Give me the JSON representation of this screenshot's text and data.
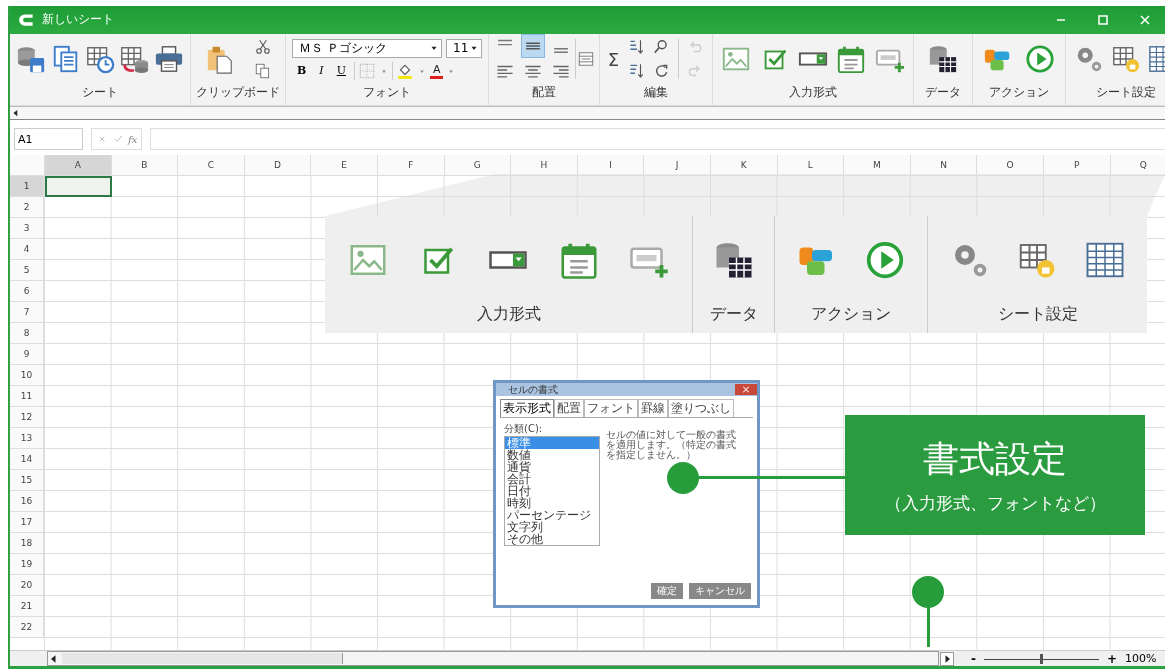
{
  "window": {
    "title": "新しいシート"
  },
  "ribbon": {
    "groups": [
      {
        "label": "シート"
      },
      {
        "label": "クリップボード"
      },
      {
        "label": "フォント"
      },
      {
        "label": "配置"
      },
      {
        "label": "編集"
      },
      {
        "label": "入力形式"
      },
      {
        "label": "データ"
      },
      {
        "label": "アクション"
      },
      {
        "label": "シート設定"
      }
    ],
    "font": {
      "name": "ＭＳ Ｐゴシック",
      "size": "11",
      "bold": "B",
      "italic": "I",
      "underline": "U",
      "font_color": "A"
    },
    "sum": "Σ",
    "vertical_align": [
      {
        "selected": false
      },
      {
        "selected": true
      },
      {
        "selected": false
      }
    ],
    "horizontal_align": [
      {
        "selected": false
      },
      {
        "selected": false
      },
      {
        "selected": false
      }
    ]
  },
  "formula_bar": {
    "cell": "A1",
    "function_label": "fx"
  },
  "sheet": {
    "columns": [
      {
        "label": "A",
        "selected": true
      },
      {
        "label": "B",
        "selected": false
      },
      {
        "label": "C",
        "selected": false
      },
      {
        "label": "D",
        "selected": false
      },
      {
        "label": "E",
        "selected": false
      },
      {
        "label": "F",
        "selected": false
      },
      {
        "label": "G",
        "selected": false
      },
      {
        "label": "H",
        "selected": false
      },
      {
        "label": "I",
        "selected": false
      },
      {
        "label": "J",
        "selected": false
      },
      {
        "label": "K",
        "selected": false
      },
      {
        "label": "L",
        "selected": false
      },
      {
        "label": "M",
        "selected": false
      },
      {
        "label": "N",
        "selected": false
      },
      {
        "label": "O",
        "selected": false
      },
      {
        "label": "P",
        "selected": false
      },
      {
        "label": "Q",
        "selected": false
      }
    ],
    "rows": [
      {
        "label": "1",
        "selected": true
      },
      {
        "label": "2",
        "selected": false
      },
      {
        "label": "3",
        "selected": false
      },
      {
        "label": "4",
        "selected": false
      },
      {
        "label": "5",
        "selected": false
      },
      {
        "label": "6",
        "selected": false
      },
      {
        "label": "7",
        "selected": false
      },
      {
        "label": "8",
        "selected": false
      },
      {
        "label": "9",
        "selected": false
      },
      {
        "label": "10",
        "selected": false
      },
      {
        "label": "11",
        "selected": false
      },
      {
        "label": "12",
        "selected": false
      },
      {
        "label": "13",
        "selected": false
      },
      {
        "label": "14",
        "selected": false
      },
      {
        "label": "15",
        "selected": false
      },
      {
        "label": "16",
        "selected": false
      },
      {
        "label": "17",
        "selected": false
      },
      {
        "label": "18",
        "selected": false
      },
      {
        "label": "19",
        "selected": false
      },
      {
        "label": "20",
        "selected": false
      },
      {
        "label": "21",
        "selected": false
      },
      {
        "label": "22",
        "selected": false
      }
    ]
  },
  "callout_zoom": {
    "groups": [
      {
        "label": "入力形式"
      },
      {
        "label": "データ"
      },
      {
        "label": "アクション"
      },
      {
        "label": "シート設定"
      }
    ]
  },
  "dialog": {
    "title": "セルの書式",
    "tabs": [
      {
        "label": "表示形式",
        "selected": true
      },
      {
        "label": "配置",
        "selected": false
      },
      {
        "label": "フォント",
        "selected": false
      },
      {
        "label": "罫線",
        "selected": false
      },
      {
        "label": "塗りつぶし",
        "selected": false
      }
    ],
    "category_label": "分類(C):",
    "categories": [
      {
        "label": "標準",
        "selected": true
      },
      {
        "label": "数値",
        "selected": false
      },
      {
        "label": "通貨",
        "selected": false
      },
      {
        "label": "会計",
        "selected": false
      },
      {
        "label": "日付",
        "selected": false
      },
      {
        "label": "時刻",
        "selected": false
      },
      {
        "label": "パーセンテージ",
        "selected": false
      },
      {
        "label": "文字列",
        "selected": false
      },
      {
        "label": "その他",
        "selected": false
      }
    ],
    "description": "セルの値に対して一般の書式を適用します。（特定の書式を指定しません。）",
    "buttons": [
      "確定",
      "キャンセル"
    ]
  },
  "annotation": {
    "title": "書式設定",
    "subtitle": "（入力形式、フォントなど）"
  },
  "zoom": {
    "minus": "-",
    "plus": "+",
    "level": 0.5,
    "reading": "100%"
  }
}
